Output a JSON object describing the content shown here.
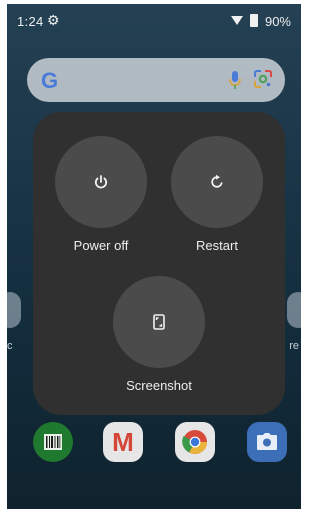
{
  "status_bar": {
    "time": "1:24",
    "battery": "90%"
  },
  "home": {
    "side_left_label": "c",
    "side_right_label": "re"
  },
  "power_menu": {
    "power_off_label": "Power off",
    "restart_label": "Restart",
    "screenshot_label": "Screenshot"
  },
  "search": {
    "logo": "G"
  },
  "dock": {
    "apps": [
      {
        "name": "barcode-app-icon"
      },
      {
        "name": "gmail-app-icon",
        "letter": "M"
      },
      {
        "name": "chrome-app-icon"
      },
      {
        "name": "camera-app-icon"
      }
    ]
  },
  "colors": {
    "menu_background": "#2f302f",
    "menu_button": "#4a4b4a",
    "wallpaper": "#2a5a78"
  }
}
